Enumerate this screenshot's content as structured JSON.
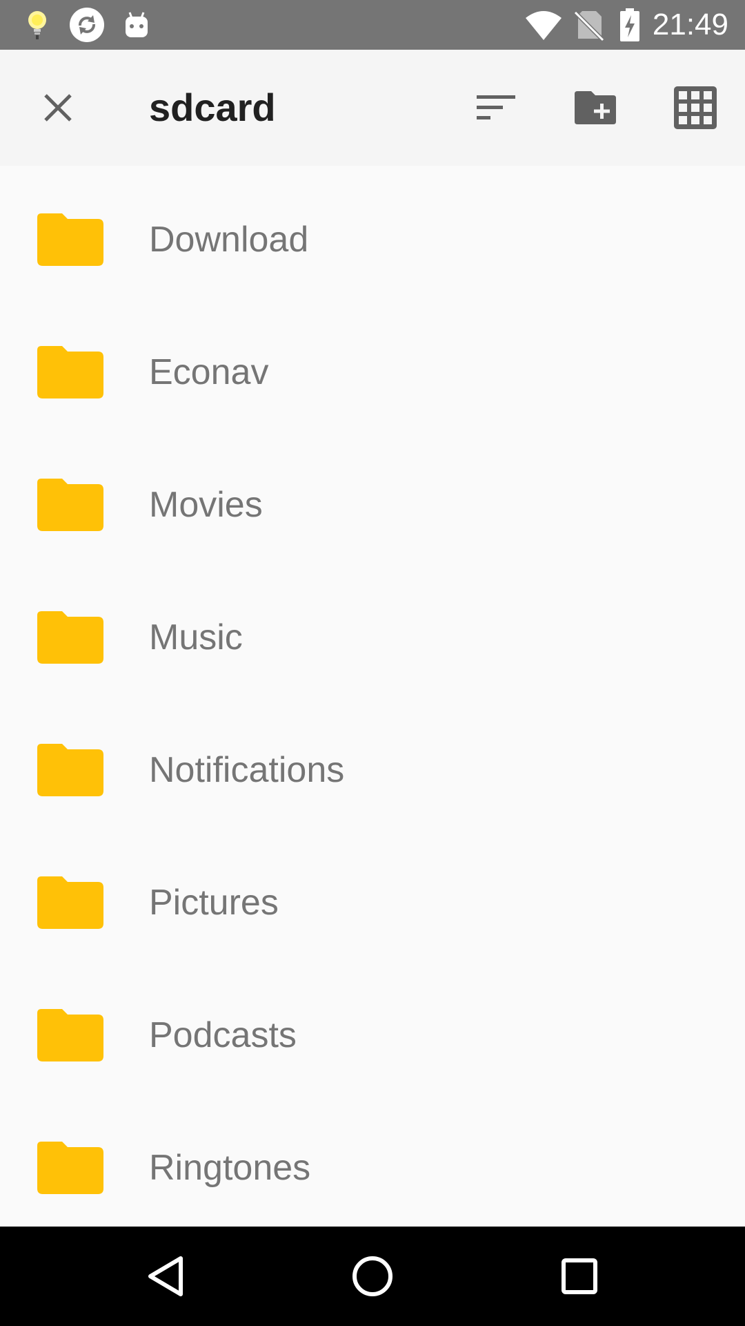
{
  "status_bar": {
    "time": "21:49",
    "left_icons": [
      "lightbulb-icon",
      "sync-icon",
      "android-icon"
    ],
    "right_icons": [
      "wifi-icon",
      "no-sim-icon",
      "battery-charging-icon"
    ]
  },
  "app_bar": {
    "title": "sdcard",
    "actions": [
      "sort-icon",
      "new-folder-icon",
      "grid-view-icon"
    ],
    "close_icon": "close-icon"
  },
  "files": [
    {
      "name": "Download",
      "icon": "folder-icon"
    },
    {
      "name": "Econav",
      "icon": "folder-icon"
    },
    {
      "name": "Movies",
      "icon": "folder-icon"
    },
    {
      "name": "Music",
      "icon": "folder-icon"
    },
    {
      "name": "Notifications",
      "icon": "folder-icon"
    },
    {
      "name": "Pictures",
      "icon": "folder-icon"
    },
    {
      "name": "Podcasts",
      "icon": "folder-icon"
    },
    {
      "name": "Ringtones",
      "icon": "folder-icon"
    }
  ],
  "nav_bar": {
    "buttons": [
      "back-icon",
      "home-icon",
      "recents-icon"
    ]
  },
  "colors": {
    "status_bar": "#757575",
    "app_bar": "#f5f5f5",
    "background": "#fafafa",
    "folder": "#ffc107",
    "title_text": "#212121",
    "item_text": "#757575",
    "icon_dark": "#616161",
    "nav_bar": "#000000"
  }
}
